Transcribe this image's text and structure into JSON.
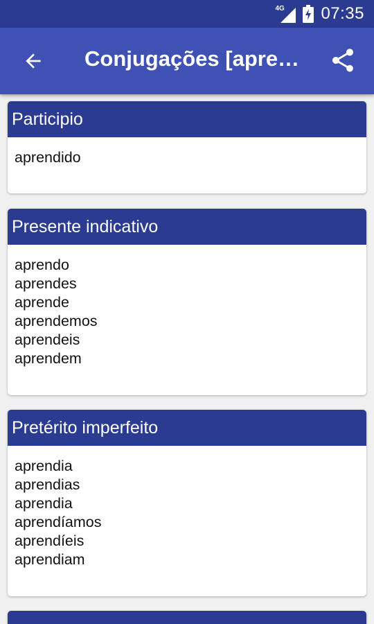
{
  "status_bar": {
    "network": "4G",
    "time": "07:35"
  },
  "app_bar": {
    "back_icon": "arrow-back-icon",
    "title": "Conjugações [apre…",
    "share_icon": "share-icon"
  },
  "sections": [
    {
      "title": "Participio",
      "forms": [
        "aprendido"
      ]
    },
    {
      "title": "Presente indicativo",
      "forms": [
        "aprendo",
        "aprendes",
        "aprende",
        "aprendemos",
        "aprendeis",
        "aprendem"
      ]
    },
    {
      "title": "Pretérito imperfeito",
      "forms": [
        "aprendia",
        "aprendias",
        "aprendia",
        "aprendíamos",
        "aprendíeis",
        "aprendiam"
      ]
    }
  ],
  "colors": {
    "status_bar": "#2c3b92",
    "app_bar": "#3f51b5",
    "card_header": "#2c3b92",
    "background": "#f0f0f0"
  }
}
